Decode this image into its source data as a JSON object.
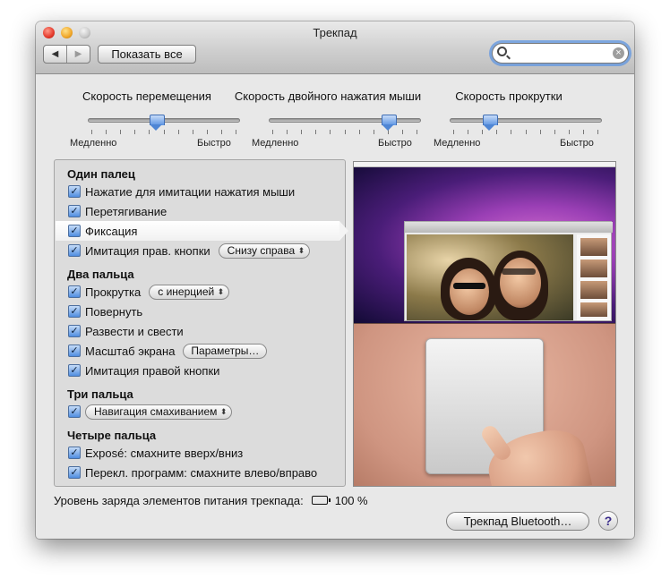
{
  "window": {
    "title": "Трекпад"
  },
  "toolbar": {
    "back": "◀",
    "forward": "▶",
    "show_all": "Показать все",
    "search": {
      "value": "",
      "placeholder": ""
    },
    "search_clear": "×"
  },
  "sliders": [
    {
      "label": "Скорость перемещения",
      "min_label": "Медленно",
      "max_label": "Быстро",
      "value": 0.45
    },
    {
      "label": "Скорость двойного нажатия мыши",
      "min_label": "Медленно",
      "max_label": "Быстро",
      "value": 0.8
    },
    {
      "label": "Скорость прокрутки",
      "min_label": "Медленно",
      "max_label": "Быстро",
      "value": 0.25
    }
  ],
  "options": {
    "one_finger": {
      "title": "Один палец",
      "tap_to_click": {
        "label": "Нажатие для имитации нажатия мыши",
        "checked": true
      },
      "dragging": {
        "label": "Перетягивание",
        "checked": true
      },
      "drag_lock": {
        "label": "Фиксация",
        "checked": true
      },
      "secondary_click": {
        "label": "Имитация прав. кнопки",
        "checked": true,
        "popup": "Снизу справа"
      }
    },
    "two_fingers": {
      "title": "Два пальца",
      "scroll": {
        "label": "Прокрутка",
        "checked": true,
        "popup": "с инерцией"
      },
      "rotate": {
        "label": "Повернуть",
        "checked": true
      },
      "pinch": {
        "label": "Развести и свести",
        "checked": true
      },
      "zoom": {
        "label": "Масштаб экрана",
        "checked": true,
        "button": "Параметры…"
      },
      "secondary_click": {
        "label": "Имитация правой кнопки",
        "checked": true
      }
    },
    "three_fingers": {
      "title": "Три пальца",
      "swipe": {
        "checked": true,
        "popup": "Навигация смахиванием"
      }
    },
    "four_fingers": {
      "title": "Четыре пальца",
      "expose": {
        "label": "Exposé: смахните вверх/вниз",
        "checked": true
      },
      "switch_apps": {
        "label": "Перекл. программ: смахните влево/вправо",
        "checked": true
      }
    }
  },
  "battery": {
    "label": "Уровень заряда элементов питания трекпада:",
    "value": "100 %",
    "level": 1.0
  },
  "footer": {
    "bluetooth_button": "Трекпад Bluetooth…",
    "help": "?"
  },
  "check_glyph": "✓"
}
